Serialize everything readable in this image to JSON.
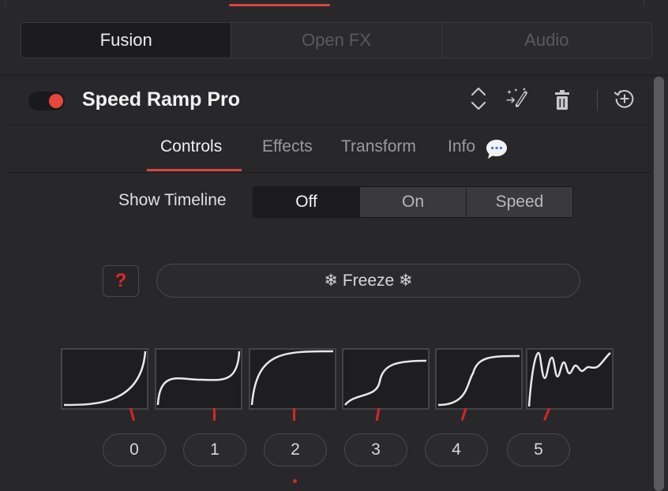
{
  "top_tabs": [
    "Fusion",
    "Open FX",
    "Audio"
  ],
  "plugin": {
    "enabled": true,
    "title": "Speed Ramp Pro",
    "icons": [
      "up-down-chevron-icon",
      "magic-wand-icon",
      "trash-icon",
      "reset-icon"
    ]
  },
  "sub_tabs": {
    "items": [
      "Controls",
      "Effects",
      "Transform",
      "Info"
    ],
    "active": "Controls",
    "info_icon": "speech-bubble-icon"
  },
  "show_timeline": {
    "label": "Show Timeline",
    "options": [
      "Off",
      "On",
      "Speed"
    ],
    "selected": "Off"
  },
  "help_button": {
    "label": "?"
  },
  "freeze_button": {
    "label": "❄ Freeze ❄"
  },
  "presets": {
    "labels": [
      "0",
      "1",
      "2",
      "3",
      "4",
      "5"
    ],
    "selected": "2"
  },
  "colors": {
    "accent": "#d9463e",
    "toggle_on": "#e5473d",
    "help": "#e5252a"
  }
}
